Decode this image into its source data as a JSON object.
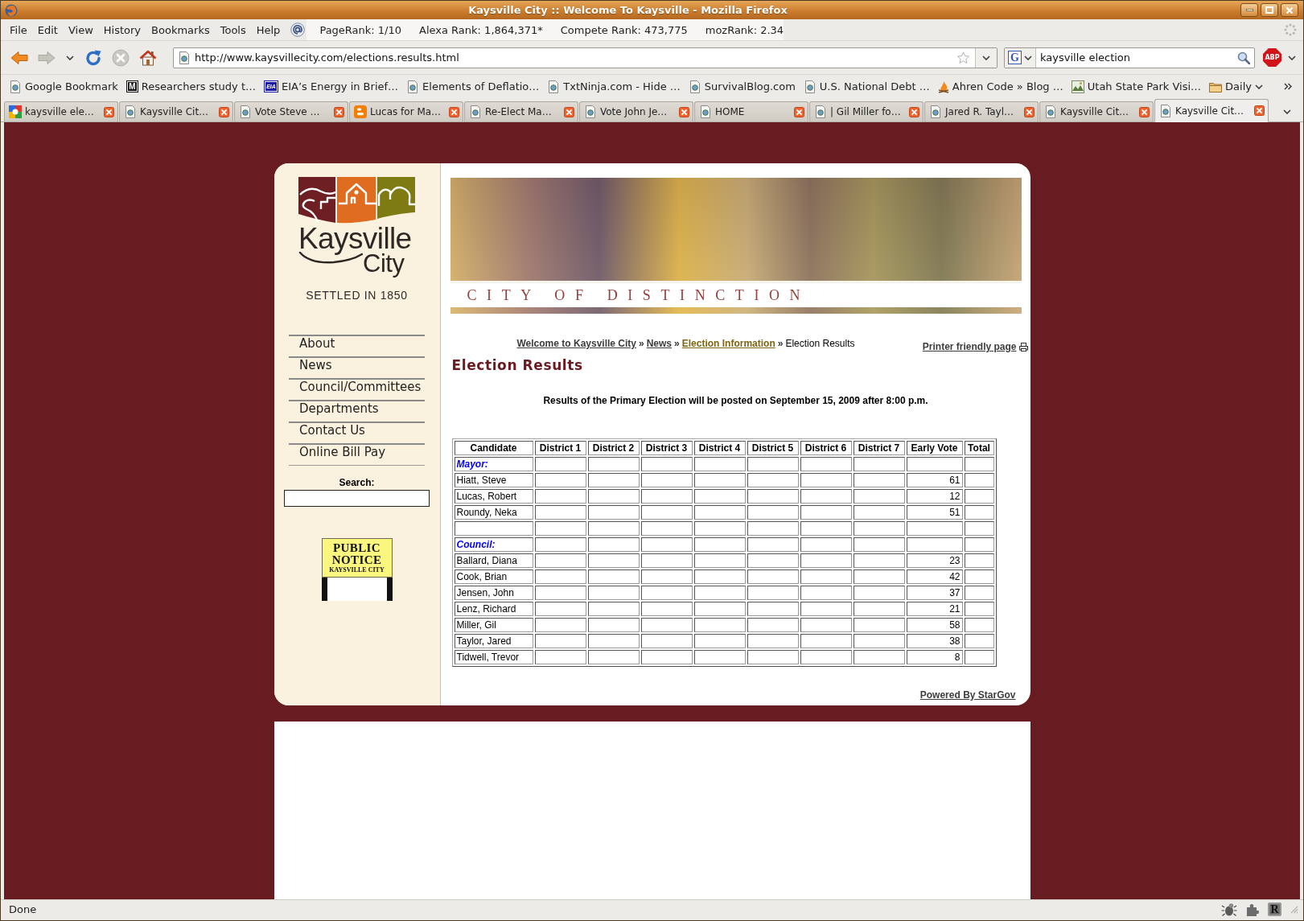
{
  "window": {
    "title": "Kaysville City :: Welcome To Kaysville - Mozilla Firefox"
  },
  "menu_bar": {
    "items": [
      "File",
      "Edit",
      "View",
      "History",
      "Bookmarks",
      "Tools",
      "Help"
    ],
    "seo_stats": [
      "PageRank: 1/10",
      "Alexa Rank: 1,864,371*",
      "Compete Rank: 473,775",
      "mozRank: 2.34"
    ]
  },
  "nav_buttons": [
    {
      "kind": "back",
      "disabled": false
    },
    {
      "kind": "forward",
      "disabled": true
    },
    {
      "kind": "recent",
      "disabled": false
    },
    {
      "kind": "reload",
      "disabled": false
    },
    {
      "kind": "stop",
      "disabled": true
    },
    {
      "kind": "home",
      "disabled": false
    }
  ],
  "address_bar": {
    "url": "http://www.kaysvillecity.com/elections.results.html",
    "bookmarked": false
  },
  "web_search": {
    "engine_label": "G",
    "value": "kaysville election"
  },
  "adblock": {
    "label": "ABP"
  },
  "bookmarks": [
    {
      "kind": "page",
      "label": "Google Bookmark"
    },
    {
      "kind": "mono-tile",
      "label": "Researchers study t…",
      "tile_label": "M"
    },
    {
      "kind": "blue-tile",
      "label": "EIA’s Energy in Brief…",
      "tile_label": "EIA"
    },
    {
      "kind": "page",
      "label": "Elements of Deflatio…"
    },
    {
      "kind": "page",
      "label": "TxtNinja.com - Hide …"
    },
    {
      "kind": "page",
      "label": "SurvivalBlog.com"
    },
    {
      "kind": "page",
      "label": "U.S. National Debt …"
    },
    {
      "kind": "flame",
      "label": "Ahren Code » Blog …"
    },
    {
      "kind": "landscape",
      "label": "Utah State Park Visi…"
    },
    {
      "kind": "folder",
      "label": "Daily"
    }
  ],
  "tabs": [
    {
      "label": "kaysville ele…",
      "kind": "google",
      "selected": false
    },
    {
      "label": "Kaysville Cit…",
      "kind": "page",
      "selected": false
    },
    {
      "label": "Vote Steve …",
      "kind": "page",
      "selected": false
    },
    {
      "label": "Lucas for Ma…",
      "kind": "blogger",
      "selected": false
    },
    {
      "label": "Re-Elect Ma…",
      "kind": "page",
      "selected": false
    },
    {
      "label": "Vote John Je…",
      "kind": "page",
      "selected": false
    },
    {
      "label": "HOME",
      "kind": "page",
      "selected": false
    },
    {
      "label": "| Gil Miller fo…",
      "kind": "page",
      "selected": false
    },
    {
      "label": "Jared R. Tayl…",
      "kind": "page",
      "selected": false
    },
    {
      "label": "Kaysville Cit…",
      "kind": "page",
      "selected": false
    },
    {
      "label": "Kaysville Cit…",
      "kind": "page",
      "selected": true
    }
  ],
  "page": {
    "logo": {
      "name": "Kaysville",
      "sub": "City",
      "tagline": "SETTLED IN 1850"
    },
    "side_nav": [
      "About",
      "News",
      "Council/Committees",
      "Departments",
      "Contact Us",
      "Online Bill Pay"
    ],
    "site_search": {
      "label": "Search:"
    },
    "public_notice": {
      "lines": [
        {
          "text": "PUBLIC",
          "kind": "heading"
        },
        {
          "text": "NOTICE",
          "kind": "heading"
        },
        {
          "text": "KAYSVILLE CITY",
          "kind": "caption"
        }
      ]
    },
    "banner": {
      "tagline": "CITY OF DISTINCTION"
    },
    "breadcrumb": [
      {
        "label": "Welcome to Kaysville City",
        "kind": "link",
        "color": "#3d3d3d"
      },
      {
        "label": "News",
        "kind": "link",
        "color": "#3d3d3d",
        "separator": "»"
      },
      {
        "label": "Election Information",
        "kind": "link",
        "color": "#7d6512",
        "separator": "»"
      },
      {
        "label": "Election Results",
        "kind": "current",
        "separator": "»"
      }
    ],
    "printer_link": "Printer friendly page",
    "title": "Election Results",
    "notice": "Results of the Primary Election will be posted on September 15, 2009 after 8:00 p.m.",
    "table": {
      "columns": [
        {
          "label": "Candidate",
          "kind": "name"
        },
        {
          "label": "District 1",
          "kind": "district"
        },
        {
          "label": "District 2",
          "kind": "district"
        },
        {
          "label": "District 3",
          "kind": "district"
        },
        {
          "label": "District 4",
          "kind": "district"
        },
        {
          "label": "District 5",
          "kind": "district"
        },
        {
          "label": "District 6",
          "kind": "district"
        },
        {
          "label": "District 7",
          "kind": "district"
        },
        {
          "label": "Early Vote",
          "kind": "early"
        },
        {
          "label": "Total",
          "kind": "total"
        }
      ],
      "rows": [
        {
          "kind": "section",
          "label": "Mayor:"
        },
        {
          "kind": "candidate",
          "name": "Hiatt, Steve",
          "early_vote": "61"
        },
        {
          "kind": "candidate",
          "name": "Lucas, Robert",
          "early_vote": "12"
        },
        {
          "kind": "candidate",
          "name": "Roundy, Neka",
          "early_vote": "51"
        },
        {
          "kind": "blank"
        },
        {
          "kind": "section",
          "label": "Council:"
        },
        {
          "kind": "candidate",
          "name": "Ballard, Diana",
          "early_vote": "23"
        },
        {
          "kind": "candidate",
          "name": "Cook, Brian",
          "early_vote": "42"
        },
        {
          "kind": "candidate",
          "name": "Jensen, John",
          "early_vote": "37"
        },
        {
          "kind": "candidate",
          "name": "Lenz, Richard",
          "early_vote": "21"
        },
        {
          "kind": "candidate",
          "name": "Miller, Gil",
          "early_vote": "58"
        },
        {
          "kind": "candidate",
          "name": "Taylor, Jared",
          "early_vote": "38"
        },
        {
          "kind": "candidate",
          "name": "Tidwell, Trevor",
          "early_vote": "8"
        }
      ]
    },
    "footer_link": "Powered By StarGov"
  },
  "status_bar": {
    "text": "Done",
    "addon_label": "R"
  }
}
